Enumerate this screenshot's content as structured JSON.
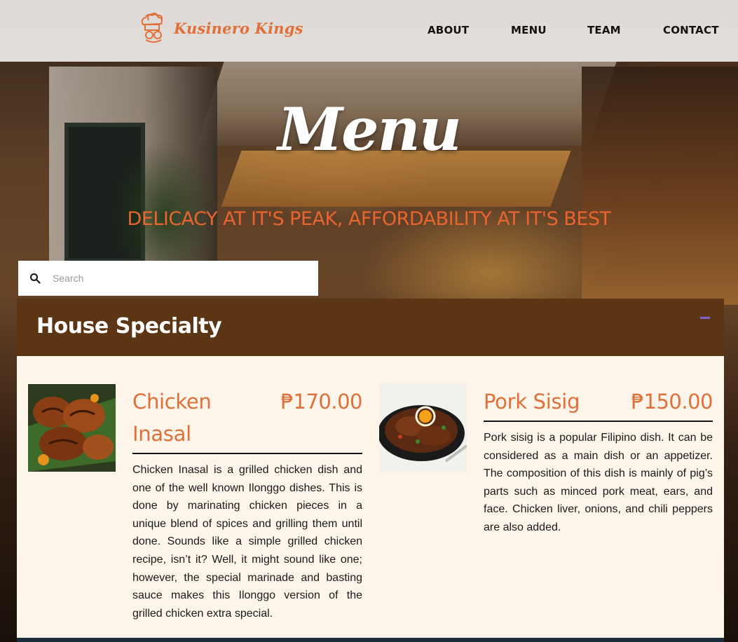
{
  "nav": {
    "logo_text": "Kusinero Kings",
    "links": [
      "ABOUT",
      "MENU",
      "TEAM",
      "CONTACT"
    ]
  },
  "hero": {
    "title": "Menu",
    "tagline": "DELICACY AT IT'S PEAK, AFFORDABILITY AT IT'S BEST"
  },
  "search": {
    "placeholder": "Search",
    "value": ""
  },
  "category": {
    "title": "House Specialty",
    "items": [
      {
        "name": "Chicken Inasal",
        "price": "₱170.00",
        "description": "Chicken Inasal is a grilled chicken dish and one of the well known Ilonggo dishes. This is done by marinating chicken pieces in a unique blend of spices and grilling them until done. Sounds like a simple grilled chicken recipe, isn’t it? Well, it might sound like one; however, the special marinade and basting sauce makes this Ilonggo version of the grilled chicken extra special."
      },
      {
        "name": "Pork Sisig",
        "price": "₱150.00",
        "description": "Pork sisig is a popular Filipino dish. It can be considered as a main dish or an appetizer. The composition of this dish is mainly of pig’s parts such as minced pork meat, ears, and face. Chicken liver, onions, and chili peppers are also added."
      }
    ]
  },
  "colors": {
    "accent": "#e0703a",
    "category_header": "#5c3514",
    "category_body": "#fdf4ea",
    "nav_bg": "#eeeae6"
  },
  "icons": {
    "logo": "chef-hats-logo-icon",
    "search": "search-icon",
    "collapse": "minus-icon"
  }
}
